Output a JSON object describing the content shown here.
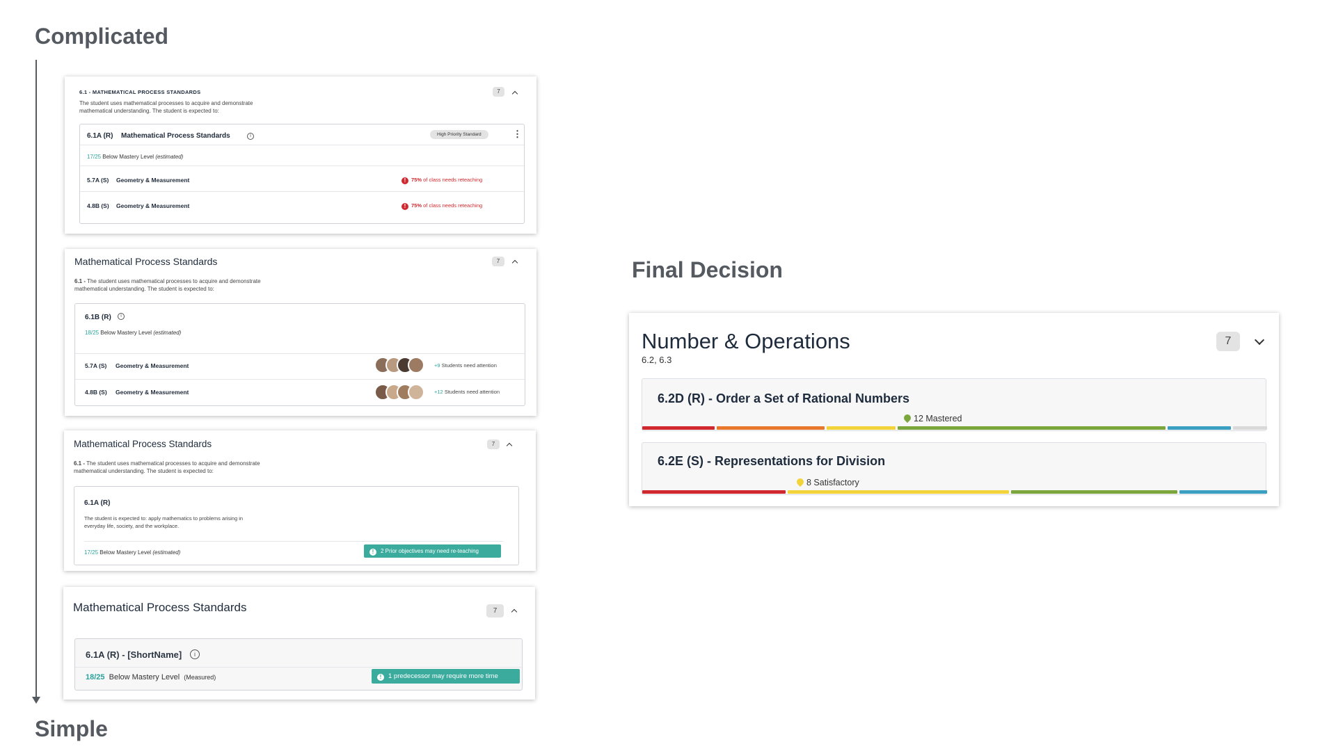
{
  "headings": {
    "complicated": "Complicated",
    "simple": "Simple",
    "final": "Final Decision"
  },
  "colors": {
    "teal": "#3aab9d",
    "red": "#d0282e",
    "orange": "#e8772b",
    "yellow": "#f2d33a",
    "green": "#7aa63c",
    "blue": "#3a9fc0",
    "gray": "#d9d9d9"
  },
  "card1": {
    "title": "6.1 - MATHEMATICAL PROCESS STANDARDS",
    "desc1": "The student uses mathematical processes to acquire and demonstrate",
    "desc2": "mathematical understanding. The student is expected to:",
    "badge": "7",
    "standard_code": "6.1A (R)",
    "standard_name": "Mathematical Process Standards",
    "priority": "High Priority Standard",
    "mastery_score": "17/25",
    "mastery_text": "Below Mastery Level",
    "mastery_note": "(estimated)",
    "rows": [
      {
        "code": "5.7A (S)",
        "name": "Geometry & Measurement",
        "alert_pct": "75%",
        "alert_text": "of class needs reteaching"
      },
      {
        "code": "4.8B (S)",
        "name": "Geometry & Measurement",
        "alert_pct": "75%",
        "alert_text": "of class needs reteaching"
      }
    ]
  },
  "card2": {
    "title": "Mathematical Process Standards",
    "badge": "7",
    "desc_prefix": "6.1 -",
    "desc1": "The student uses mathematical processes to acquire and demonstrate",
    "desc2": "mathematical understanding. The student is expected to:",
    "standard_code": "6.1B (R)",
    "mastery_score": "18/25",
    "mastery_text": "Below Mastery Level",
    "mastery_note": "(estimated)",
    "rows": [
      {
        "code": "5.7A (S)",
        "name": "Geometry & Measurement",
        "count": "+9",
        "text": "Students need attention"
      },
      {
        "code": "4.8B (S)",
        "name": "Geometry & Measurement",
        "count": "+12",
        "text": "Students need attention"
      }
    ]
  },
  "card3": {
    "title": "Mathematical Process Standards",
    "badge": "7",
    "desc_prefix": "6.1 -",
    "desc1": "The student uses mathematical processes to acquire and demonstrate",
    "desc2": "mathematical understanding. The student is expected to:",
    "standard_code": "6.1A (R)",
    "expect1": "The student is expected to: apply mathematics to problems arising in",
    "expect2": "everyday life, society, and the workplace.",
    "mastery_score": "17/25",
    "mastery_text": "Below Mastery Level",
    "mastery_note": "(estimated)",
    "pill": "2 Prior objectives may need re-teaching"
  },
  "card4": {
    "title": "Mathematical Process Standards",
    "badge": "7",
    "standard": "6.1A (R) - [ShortName]",
    "mastery_score": "18/25",
    "mastery_text": "Below Mastery Level",
    "mastery_note": "(Measured)",
    "pill": "1 predecessor may require more time"
  },
  "final": {
    "title": "Number & Operations",
    "subtitle": "6.2, 6.3",
    "badge": "7",
    "rows": [
      {
        "title": "6.2D (R) - Order a Set of Rational Numbers",
        "marker": "12 Mastered",
        "marker_color": "#7aa63c"
      },
      {
        "title": "6.2E (S) - Representations for Division",
        "marker": "8 Satisfactory",
        "marker_color": "#f2d33a"
      }
    ]
  }
}
